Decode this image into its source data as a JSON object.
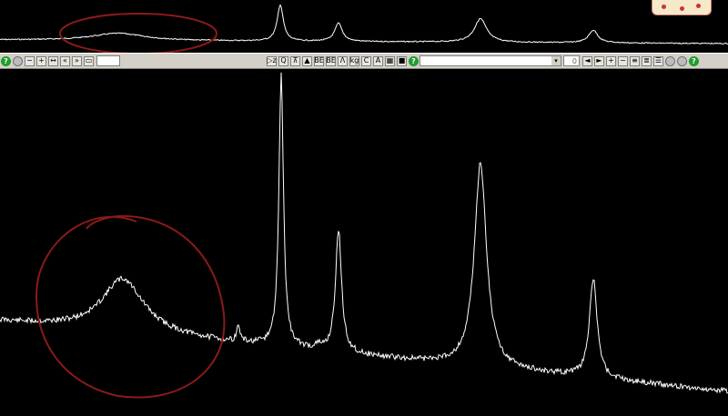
{
  "overview_panel": {
    "spectrum_color": "#ffffff",
    "annotation_color": "#8b1a1a"
  },
  "toolbar": {
    "left_help_icon": "help-icon",
    "zoom_field_value": "",
    "tool_icons": [
      {
        "name": "select-zoom-icon",
        "glyph": "▷z"
      },
      {
        "name": "magnify-icon",
        "glyph": "Q"
      },
      {
        "name": "peak-pick-icon",
        "glyph": "⊼"
      },
      {
        "name": "integrate-icon",
        "glyph": "▲"
      },
      {
        "name": "baseline-icon",
        "glyph": "BE"
      },
      {
        "name": "baseline2-icon",
        "glyph": "BE"
      },
      {
        "name": "multiplet-icon",
        "glyph": "Λ"
      },
      {
        "name": "kg-icon",
        "glyph": "kg"
      },
      {
        "name": "calibrate-icon",
        "glyph": "C"
      },
      {
        "name": "cut-icon",
        "glyph": "A"
      },
      {
        "name": "grid-icon",
        "glyph": "▦"
      },
      {
        "name": "layout-icon",
        "glyph": "■"
      },
      {
        "name": "help-icon-2",
        "glyph": "?"
      }
    ],
    "combo_value": "",
    "counter_value": "0"
  },
  "main_panel": {
    "spectrum_color": "#ffffff",
    "annotation_color": "#8b1a1a"
  }
}
